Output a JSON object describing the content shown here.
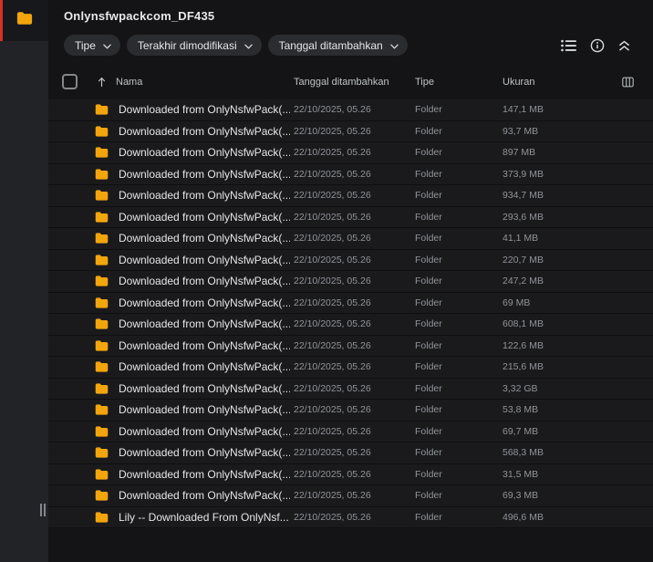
{
  "header": {
    "title": "Onlynsfwpackcom_DF435"
  },
  "sidebar": {
    "active_item": {
      "icon": "folder-icon",
      "indicator_color": "#d93025"
    },
    "resize_handle": "drag-handle"
  },
  "filters": {
    "chips": [
      {
        "label": "Tipe",
        "icon": "chevron-down-icon"
      },
      {
        "label": "Terakhir dimodifikasi",
        "icon": "chevron-down-icon"
      },
      {
        "label": "Tanggal ditambahkan",
        "icon": "chevron-down-icon"
      }
    ]
  },
  "toolbar": {
    "icons": [
      "list-view-icon",
      "info-icon",
      "collapse-icon"
    ]
  },
  "table": {
    "columns": {
      "name": "Nama",
      "date_added": "Tanggal ditambahkan",
      "type": "Tipe",
      "size": "Ukuran"
    },
    "sort": {
      "column": "Nama",
      "direction": "ascending",
      "icon": "sort-arrow-up-icon"
    },
    "column_settings_icon": "column-view-icon",
    "rows": [
      {
        "name": "Downloaded from OnlyNsfwPack(...",
        "date_added": "22/10/2025, 05.26",
        "type": "Folder",
        "size": "147,1 MB"
      },
      {
        "name": "Downloaded from OnlyNsfwPack(...",
        "date_added": "22/10/2025, 05.26",
        "type": "Folder",
        "size": "93,7 MB"
      },
      {
        "name": "Downloaded from OnlyNsfwPack(...",
        "date_added": "22/10/2025, 05.26",
        "type": "Folder",
        "size": "897 MB"
      },
      {
        "name": "Downloaded from OnlyNsfwPack(...",
        "date_added": "22/10/2025, 05.26",
        "type": "Folder",
        "size": "373,9 MB"
      },
      {
        "name": "Downloaded from OnlyNsfwPack(...",
        "date_added": "22/10/2025, 05.26",
        "type": "Folder",
        "size": "934,7 MB"
      },
      {
        "name": "Downloaded from OnlyNsfwPack(...",
        "date_added": "22/10/2025, 05.26",
        "type": "Folder",
        "size": "293,6 MB"
      },
      {
        "name": "Downloaded from OnlyNsfwPack(...",
        "date_added": "22/10/2025, 05.26",
        "type": "Folder",
        "size": "41,1 MB"
      },
      {
        "name": "Downloaded from OnlyNsfwPack(...",
        "date_added": "22/10/2025, 05.26",
        "type": "Folder",
        "size": "220,7 MB"
      },
      {
        "name": "Downloaded from OnlyNsfwPack(...",
        "date_added": "22/10/2025, 05.26",
        "type": "Folder",
        "size": "247,2 MB"
      },
      {
        "name": "Downloaded from OnlyNsfwPack(...",
        "date_added": "22/10/2025, 05.26",
        "type": "Folder",
        "size": "69 MB"
      },
      {
        "name": "Downloaded from OnlyNsfwPack(...",
        "date_added": "22/10/2025, 05.26",
        "type": "Folder",
        "size": "608,1 MB"
      },
      {
        "name": "Downloaded from OnlyNsfwPack(...",
        "date_added": "22/10/2025, 05.26",
        "type": "Folder",
        "size": "122,6 MB"
      },
      {
        "name": "Downloaded from OnlyNsfwPack(...",
        "date_added": "22/10/2025, 05.26",
        "type": "Folder",
        "size": "215,6 MB"
      },
      {
        "name": "Downloaded from OnlyNsfwPack(...",
        "date_added": "22/10/2025, 05.26",
        "type": "Folder",
        "size": "3,32 GB"
      },
      {
        "name": "Downloaded from OnlyNsfwPack(...",
        "date_added": "22/10/2025, 05.26",
        "type": "Folder",
        "size": "53,8 MB"
      },
      {
        "name": "Downloaded from OnlyNsfwPack(...",
        "date_added": "22/10/2025, 05.26",
        "type": "Folder",
        "size": "69,7 MB"
      },
      {
        "name": "Downloaded from OnlyNsfwPack(...",
        "date_added": "22/10/2025, 05.26",
        "type": "Folder",
        "size": "568,3 MB"
      },
      {
        "name": "Downloaded from OnlyNsfwPack(...",
        "date_added": "22/10/2025, 05.26",
        "type": "Folder",
        "size": "31,5 MB"
      },
      {
        "name": "Downloaded from OnlyNsfwPack(...",
        "date_added": "22/10/2025, 05.26",
        "type": "Folder",
        "size": "69,3 MB"
      },
      {
        "name": "Lily -- Downloaded From OnlyNsf...",
        "date_added": "22/10/2025, 05.26",
        "type": "Folder",
        "size": "496,6 MB"
      }
    ]
  },
  "colors": {
    "folder": "#f2a50c",
    "active_indicator": "#d93025",
    "row_background": "#1a1a1d",
    "sidebar_background": "#222327",
    "main_background": "#141416",
    "chip_background": "#2b2c30"
  }
}
